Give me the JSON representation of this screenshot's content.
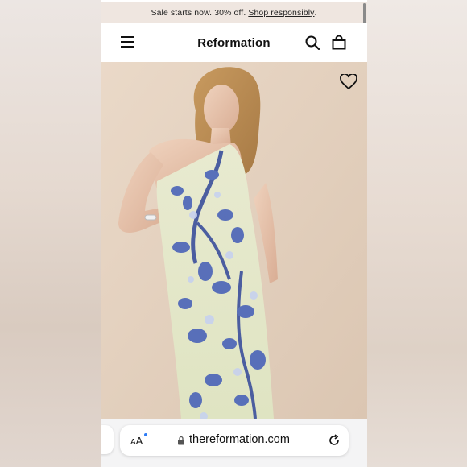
{
  "promo": {
    "text": "Sale starts now. 30% off. ",
    "link": "Shop responsibly",
    "suffix": "."
  },
  "header": {
    "brand": "Reformation",
    "icons": [
      "menu-icon",
      "search-icon",
      "bag-icon"
    ]
  },
  "hero": {
    "icons": [
      "heart-icon"
    ],
    "colors": {
      "background": "#e2cfbd",
      "dress_base": "#e6e8c8",
      "floral": "#4a63b8"
    }
  },
  "browser": {
    "text_size_label": "AA",
    "url": "thereformation.com",
    "icons": [
      "lock-icon",
      "reload-icon"
    ]
  }
}
